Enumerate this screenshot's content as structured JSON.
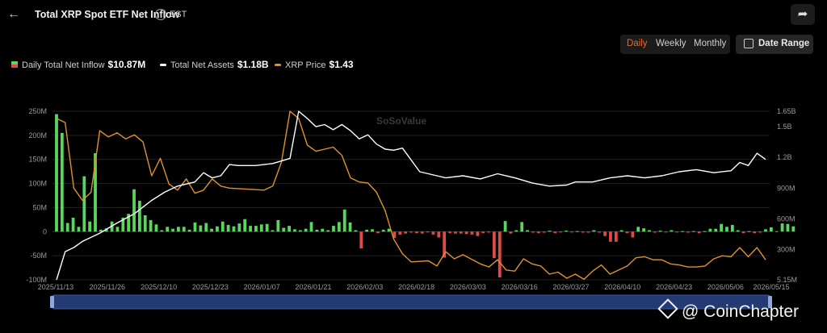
{
  "header": {
    "back_icon": "arrow-left-icon",
    "title": "Total XRP Spot ETF Net Inflow",
    "info_icon": "info-icon",
    "timezone": "EST",
    "share_icon": "share-icon"
  },
  "range_buttons": [
    {
      "label": "Daily",
      "active": true
    },
    {
      "label": "Weekly",
      "active": false
    },
    {
      "label": "Monthly",
      "active": false
    }
  ],
  "date_range_label": "Date Range",
  "legend": [
    {
      "label": "Daily Total Net Inflow",
      "value": "$10.87M"
    },
    {
      "label": "Total Net Assets",
      "value": "$1.18B"
    },
    {
      "label": "XRP Price",
      "value": "$1.43"
    }
  ],
  "chart_watermark": "SoSoValue",
  "brand_watermark": "@ CoinChapter",
  "colors": {
    "accent": "#e8672c",
    "inflow_positive": "#59d65e",
    "inflow_negative": "#e04a4a",
    "assets_line": "#ffffff",
    "price_line": "#e0922a"
  },
  "chart_data": {
    "type": "bar+line",
    "left_axis": {
      "ticks": [
        "250M",
        "200M",
        "150M",
        "100M",
        "50M",
        "0",
        "-50M",
        "-100M"
      ],
      "range": [
        -100,
        250
      ],
      "unit": "M"
    },
    "right_axis": {
      "ticks": [
        "1.65B",
        "1.5B",
        "1.2B",
        "900M",
        "600M",
        "300M",
        "5.15M"
      ],
      "range": [
        5.15,
        1650
      ],
      "unit": "M"
    },
    "x_ticks": [
      "2025/11/13",
      "2025/11/26",
      "2025/12/10",
      "2025/12/23",
      "2026/01/07",
      "2026/01/21",
      "2026/02/03",
      "2026/02/18",
      "2026/03/03",
      "2026/03/16",
      "2026/03/27",
      "2026/04/10",
      "2026/04/23",
      "2026/05/06",
      "2026/05/15"
    ],
    "n_days": 129,
    "series": [
      {
        "name": "Daily Total Net Inflow",
        "kind": "bar",
        "values": [
          244,
          205,
          18,
          29,
          10,
          115,
          21,
          163,
          4,
          7,
          21,
          10,
          29,
          37,
          88,
          64,
          34,
          24,
          15,
          3,
          10,
          6,
          10,
          10,
          4,
          19,
          13,
          18,
          6,
          11,
          21,
          14,
          11,
          17,
          26,
          12,
          12,
          15,
          16,
          3,
          24,
          8,
          12,
          5,
          3,
          6,
          20,
          4,
          6,
          3,
          12,
          20,
          46,
          19,
          3,
          -35,
          4,
          5,
          -3,
          4,
          6,
          -13,
          -6,
          -4,
          -2,
          -3,
          -4,
          -1,
          -6,
          -12,
          -54,
          -3,
          -4,
          -4,
          -5,
          -6,
          -9,
          -3,
          -2,
          -55,
          -95,
          22,
          -4,
          3,
          20,
          3,
          -2,
          -3,
          -2,
          2,
          -3,
          -1,
          2,
          -1,
          1,
          -2,
          -2,
          3,
          -2,
          -9,
          -21,
          -21,
          3,
          -3,
          -12,
          10,
          7,
          3,
          -2,
          2,
          -1,
          3,
          -1,
          1,
          -2,
          1,
          -3,
          1,
          6,
          6,
          16,
          10,
          14,
          3,
          -3,
          1,
          -3,
          -2,
          5,
          9,
          1,
          17,
          16,
          11
        ]
      },
      {
        "name": "Total Net Assets",
        "kind": "line",
        "points": [
          [
            0,
            5
          ],
          [
            2,
            280
          ],
          [
            4,
            320
          ],
          [
            6,
            380
          ],
          [
            10,
            460
          ],
          [
            14,
            560
          ],
          [
            18,
            650
          ],
          [
            22,
            780
          ],
          [
            25,
            860
          ],
          [
            28,
            920
          ],
          [
            32,
            960
          ],
          [
            34,
            1050
          ],
          [
            36,
            1000
          ],
          [
            38,
            1020
          ],
          [
            40,
            1130
          ],
          [
            42,
            1120
          ],
          [
            46,
            1120
          ],
          [
            50,
            1140
          ],
          [
            54,
            1190
          ],
          [
            56,
            1650
          ],
          [
            58,
            1580
          ],
          [
            60,
            1500
          ],
          [
            62,
            1520
          ],
          [
            64,
            1470
          ],
          [
            66,
            1520
          ],
          [
            68,
            1460
          ],
          [
            70,
            1380
          ],
          [
            72,
            1420
          ],
          [
            74,
            1330
          ],
          [
            76,
            1280
          ],
          [
            78,
            1270
          ],
          [
            80,
            1290
          ],
          [
            84,
            1060
          ],
          [
            86,
            1040
          ],
          [
            88,
            1020
          ],
          [
            90,
            1000
          ],
          [
            94,
            1020
          ],
          [
            98,
            990
          ],
          [
            102,
            1040
          ],
          [
            106,
            1000
          ],
          [
            110,
            950
          ],
          [
            114,
            920
          ],
          [
            118,
            930
          ],
          [
            120,
            960
          ],
          [
            124,
            960
          ],
          [
            128,
            1000
          ],
          [
            132,
            1020
          ],
          [
            136,
            1000
          ],
          [
            140,
            1020
          ],
          [
            144,
            1060
          ],
          [
            148,
            1080
          ],
          [
            152,
            1050
          ],
          [
            156,
            1070
          ],
          [
            158,
            1150
          ],
          [
            160,
            1120
          ],
          [
            162,
            1240
          ],
          [
            164,
            1180
          ]
        ]
      },
      {
        "name": "XRP Price",
        "kind": "line",
        "points": [
          [
            0,
            1580
          ],
          [
            2,
            1540
          ],
          [
            4,
            900
          ],
          [
            6,
            780
          ],
          [
            8,
            860
          ],
          [
            10,
            1460
          ],
          [
            12,
            1400
          ],
          [
            14,
            1440
          ],
          [
            16,
            1380
          ],
          [
            18,
            1420
          ],
          [
            20,
            1350
          ],
          [
            22,
            1020
          ],
          [
            24,
            1190
          ],
          [
            26,
            940
          ],
          [
            28,
            880
          ],
          [
            30,
            990
          ],
          [
            32,
            850
          ],
          [
            34,
            880
          ],
          [
            36,
            990
          ],
          [
            38,
            920
          ],
          [
            40,
            900
          ],
          [
            44,
            890
          ],
          [
            48,
            880
          ],
          [
            50,
            920
          ],
          [
            52,
            1150
          ],
          [
            54,
            1650
          ],
          [
            56,
            1580
          ],
          [
            58,
            1320
          ],
          [
            60,
            1260
          ],
          [
            62,
            1280
          ],
          [
            64,
            1300
          ],
          [
            66,
            1220
          ],
          [
            68,
            1000
          ],
          [
            70,
            960
          ],
          [
            72,
            950
          ],
          [
            74,
            860
          ],
          [
            76,
            680
          ],
          [
            78,
            400
          ],
          [
            80,
            260
          ],
          [
            82,
            180
          ],
          [
            86,
            190
          ],
          [
            88,
            140
          ],
          [
            90,
            280
          ],
          [
            92,
            210
          ],
          [
            94,
            250
          ],
          [
            98,
            160
          ],
          [
            100,
            130
          ],
          [
            102,
            200
          ],
          [
            104,
            100
          ],
          [
            106,
            90
          ],
          [
            108,
            210
          ],
          [
            110,
            160
          ],
          [
            112,
            140
          ],
          [
            114,
            60
          ],
          [
            116,
            80
          ],
          [
            118,
            20
          ],
          [
            120,
            60
          ],
          [
            122,
            10
          ],
          [
            124,
            90
          ],
          [
            126,
            150
          ],
          [
            128,
            60
          ],
          [
            130,
            100
          ],
          [
            132,
            140
          ],
          [
            134,
            220
          ],
          [
            136,
            230
          ],
          [
            138,
            200
          ],
          [
            140,
            200
          ],
          [
            142,
            160
          ],
          [
            144,
            150
          ],
          [
            146,
            130
          ],
          [
            148,
            130
          ],
          [
            150,
            140
          ],
          [
            152,
            210
          ],
          [
            154,
            240
          ],
          [
            156,
            230
          ],
          [
            158,
            320
          ],
          [
            160,
            230
          ],
          [
            162,
            320
          ],
          [
            164,
            200
          ]
        ]
      }
    ]
  }
}
